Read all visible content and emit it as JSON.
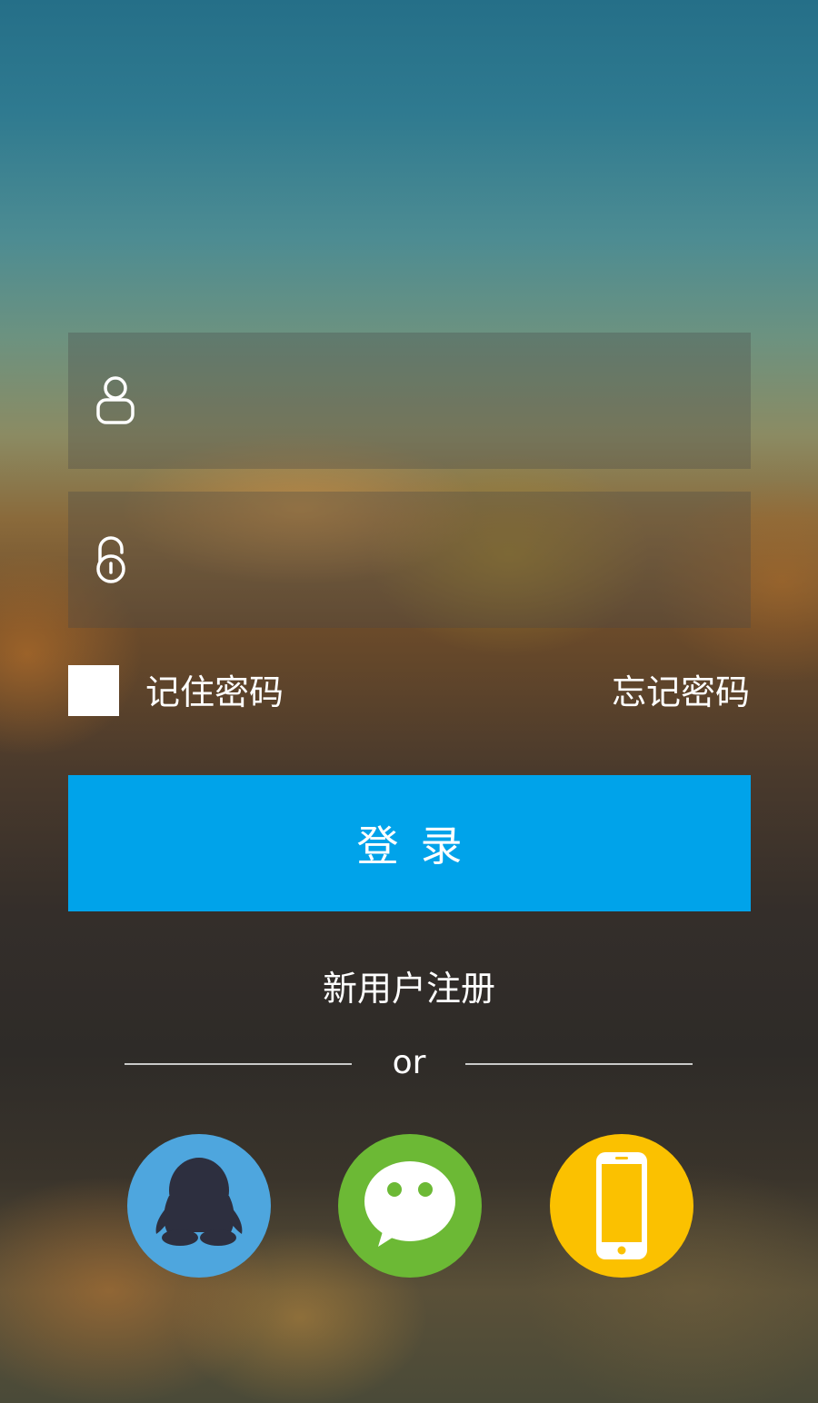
{
  "login_form": {
    "username_placeholder": "",
    "password_placeholder": "",
    "remember_label": "记住密码",
    "forgot_label": "忘记密码",
    "login_label": "登录"
  },
  "register": {
    "label": "新用户注册"
  },
  "divider": {
    "text": "or"
  },
  "social": {
    "qq": {
      "icon": "qq-penguin-icon",
      "color": "#4ea6de"
    },
    "wechat": {
      "icon": "wechat-bubble-icon",
      "color": "#6cb935"
    },
    "phone": {
      "icon": "mobile-phone-icon",
      "color": "#fbc100"
    }
  },
  "colors": {
    "primary": "#00a3ea"
  }
}
